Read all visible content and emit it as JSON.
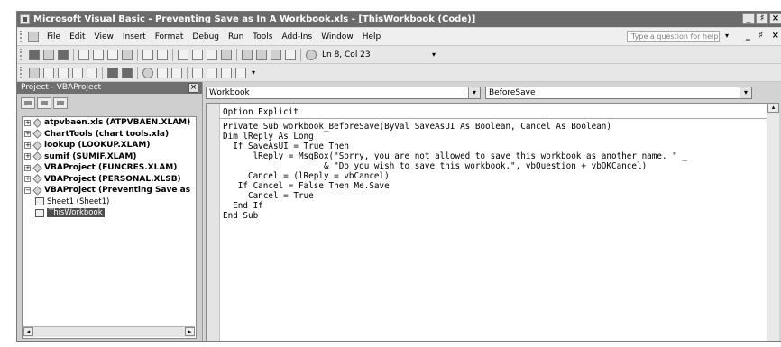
{
  "window": {
    "title": "Microsoft Visual Basic - Preventing Save as In A Workbook.xls - [ThisWorkbook (Code)]",
    "controls": [
      "_",
      "♯",
      "×"
    ]
  },
  "menu": {
    "items": [
      "File",
      "Edit",
      "View",
      "Insert",
      "Format",
      "Debug",
      "Run",
      "Tools",
      "Add-Ins",
      "Window",
      "Help"
    ],
    "help_placeholder": "Type a question for help",
    "mdi_controls": "_ ♯ ×"
  },
  "toolbar": {
    "position": "Ln 8, Col 23"
  },
  "project": {
    "title": "Project - VBAProject",
    "close": "×",
    "nodes": [
      {
        "label": "atpvbaen.xls (ATPVBAEN.XLAM)",
        "expander": "+"
      },
      {
        "label": "ChartTools (chart tools.xla)",
        "expander": "+"
      },
      {
        "label": "lookup (LOOKUP.XLAM)",
        "expander": "+"
      },
      {
        "label": "sumif (SUMIF.XLAM)",
        "expander": "+"
      },
      {
        "label": "VBAProject (FUNCRES.XLAM)",
        "expander": "+"
      },
      {
        "label": "VBAProject (PERSONAL.XLSB)",
        "expander": "+"
      },
      {
        "label": "VBAProject (Preventing Save as",
        "expander": "−"
      }
    ],
    "children": [
      {
        "label": "Sheet1 (Sheet1)",
        "selected": false
      },
      {
        "label": "ThisWorkbook",
        "selected": true
      }
    ]
  },
  "code": {
    "object": "Workbook",
    "procedure": "BeforeSave",
    "lines": [
      "Option Explicit",
      "",
      "Private Sub workbook_BeforeSave(ByVal SaveAsUI As Boolean, Cancel As Boolean)",
      "Dim lReply As Long",
      "  If SaveAsUI = True Then",
      "      lReply = MsgBox(\"Sorry, you are not allowed to save this workbook as another name. \" _",
      "                    & \"Do you wish to save this workbook.\", vbQuestion + vbOKCancel)",
      "     Cancel = (lReply = vbCancel)",
      "   If Cancel = False Then Me.Save",
      "     Cancel = True",
      "  End If",
      "End Sub"
    ]
  }
}
